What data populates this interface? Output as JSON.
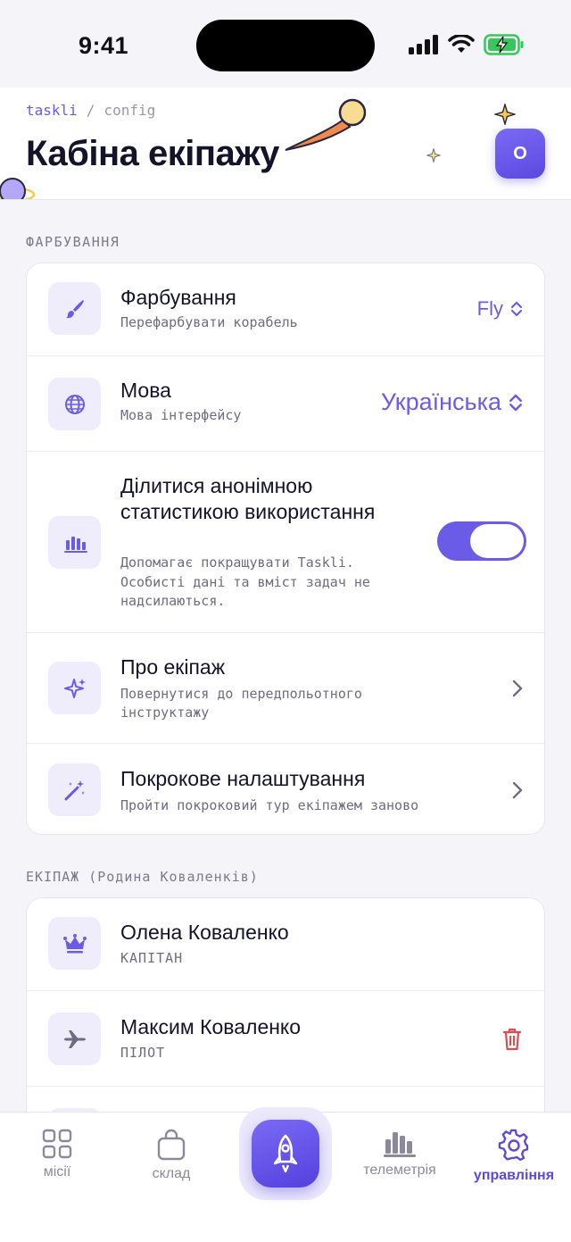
{
  "status_bar": {
    "time": "9:41"
  },
  "header": {
    "breadcrumb": {
      "brand": "taskli",
      "separator": "/",
      "current": "config"
    },
    "title": "Кабіна екіпажу",
    "avatar_initial": "О"
  },
  "section_ship": {
    "label": "ФАРБУВАННЯ",
    "rows": [
      {
        "title": "Фарбування",
        "subtitle": "Перефарбувати корабель",
        "value": "Fly",
        "icon": "paintbrush-icon"
      },
      {
        "title": "Мова",
        "subtitle": "Мова інтерфейсу",
        "value": "Українська",
        "icon": "globe-icon"
      },
      {
        "title": "Ділитися анонімною статистикою використання",
        "subtitle": "Допомагає покращувати Taskli. Особисті дані та вміст задач не надсилаються.",
        "toggle_on": true,
        "icon": "bar-chart-icon"
      },
      {
        "title": "Про екіпаж",
        "subtitle": "Повернутися до передпольотного інструктажу",
        "icon": "sparkles-icon"
      },
      {
        "title": "Покрокове налаштування",
        "subtitle": "Пройти покроковий тур екіпажем заново",
        "icon": "magic-wand-icon"
      }
    ]
  },
  "section_crew": {
    "label": "ЕКІПАЖ (Родина Коваленків)",
    "members": [
      {
        "name": "Олена Коваленко",
        "role": "КАПІТАН",
        "icon": "crown-icon"
      },
      {
        "name": "Максим Коваленко",
        "role": "ПІЛОТ",
        "icon": "plane-icon",
        "deletable": true
      }
    ]
  },
  "bottom_nav": {
    "items": [
      {
        "label": "місії",
        "icon": "grid-icon"
      },
      {
        "label": "склад",
        "icon": "bag-icon"
      },
      {
        "label": "",
        "icon": "rocket-icon"
      },
      {
        "label": "телеметрія",
        "icon": "bar-chart-icon"
      },
      {
        "label": "управління",
        "icon": "gear-icon",
        "active": true
      }
    ]
  },
  "colors": {
    "accent": "#6b5ce7",
    "danger": "#e5484d",
    "battery": "#34c759"
  }
}
